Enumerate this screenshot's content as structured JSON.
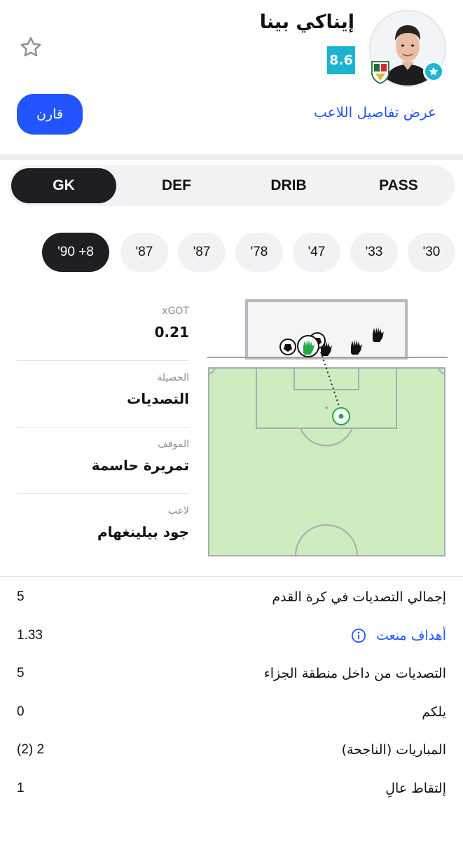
{
  "player": {
    "name": "إيناكي بينا",
    "rating": "8.6",
    "details_link": "عرض تفاصيل اللاعب",
    "compare_label": "قارن"
  },
  "categories": [
    {
      "label": "GK",
      "active": true
    },
    {
      "label": "DEF",
      "active": false
    },
    {
      "label": "DRIB",
      "active": false
    },
    {
      "label": "PASS",
      "active": false
    }
  ],
  "minutes": [
    {
      "label": "'90 +8",
      "active": true
    },
    {
      "label": "'87",
      "active": false
    },
    {
      "label": "'87",
      "active": false
    },
    {
      "label": "'78",
      "active": false
    },
    {
      "label": "'47",
      "active": false
    },
    {
      "label": "'33",
      "active": false
    },
    {
      "label": "'30",
      "active": false
    }
  ],
  "shot": {
    "xgot_label": "xGOT",
    "xgot_value": "0.21",
    "outcome_label": "الحصيلة",
    "outcome_value": "التصديات",
    "situation_label": "الموقف",
    "situation_value": "تمريرة حاسمة",
    "player_label": "لاعب",
    "player_value": "جود بيلينغهام"
  },
  "stats": [
    {
      "label": "إجمالي التصديات في كرة القدم",
      "value": "5",
      "link": false
    },
    {
      "label": "أهداف منعت",
      "value": "1.33",
      "link": true
    },
    {
      "label": "التصديات من داخل منطقة الجزاء",
      "value": "5",
      "link": false
    },
    {
      "label": "يلكم",
      "value": "0",
      "link": false
    },
    {
      "label": "المباريات (الناجحة)",
      "value": "(2) 2",
      "link": false
    },
    {
      "label": "إلتقاط عالِ",
      "value": "1",
      "link": false
    }
  ],
  "colors": {
    "accent": "#2255ff",
    "rating": "#1bb3cf",
    "pitch": "#cfebc0",
    "active_chip": "#1e1f22",
    "save_marker": "#22aa44"
  },
  "icons": {
    "favorite": "star-outline-icon",
    "star_badge": "star-icon",
    "info": "info-circle-icon",
    "save": "goalkeeper-glove-icon",
    "ball": "football-icon"
  }
}
